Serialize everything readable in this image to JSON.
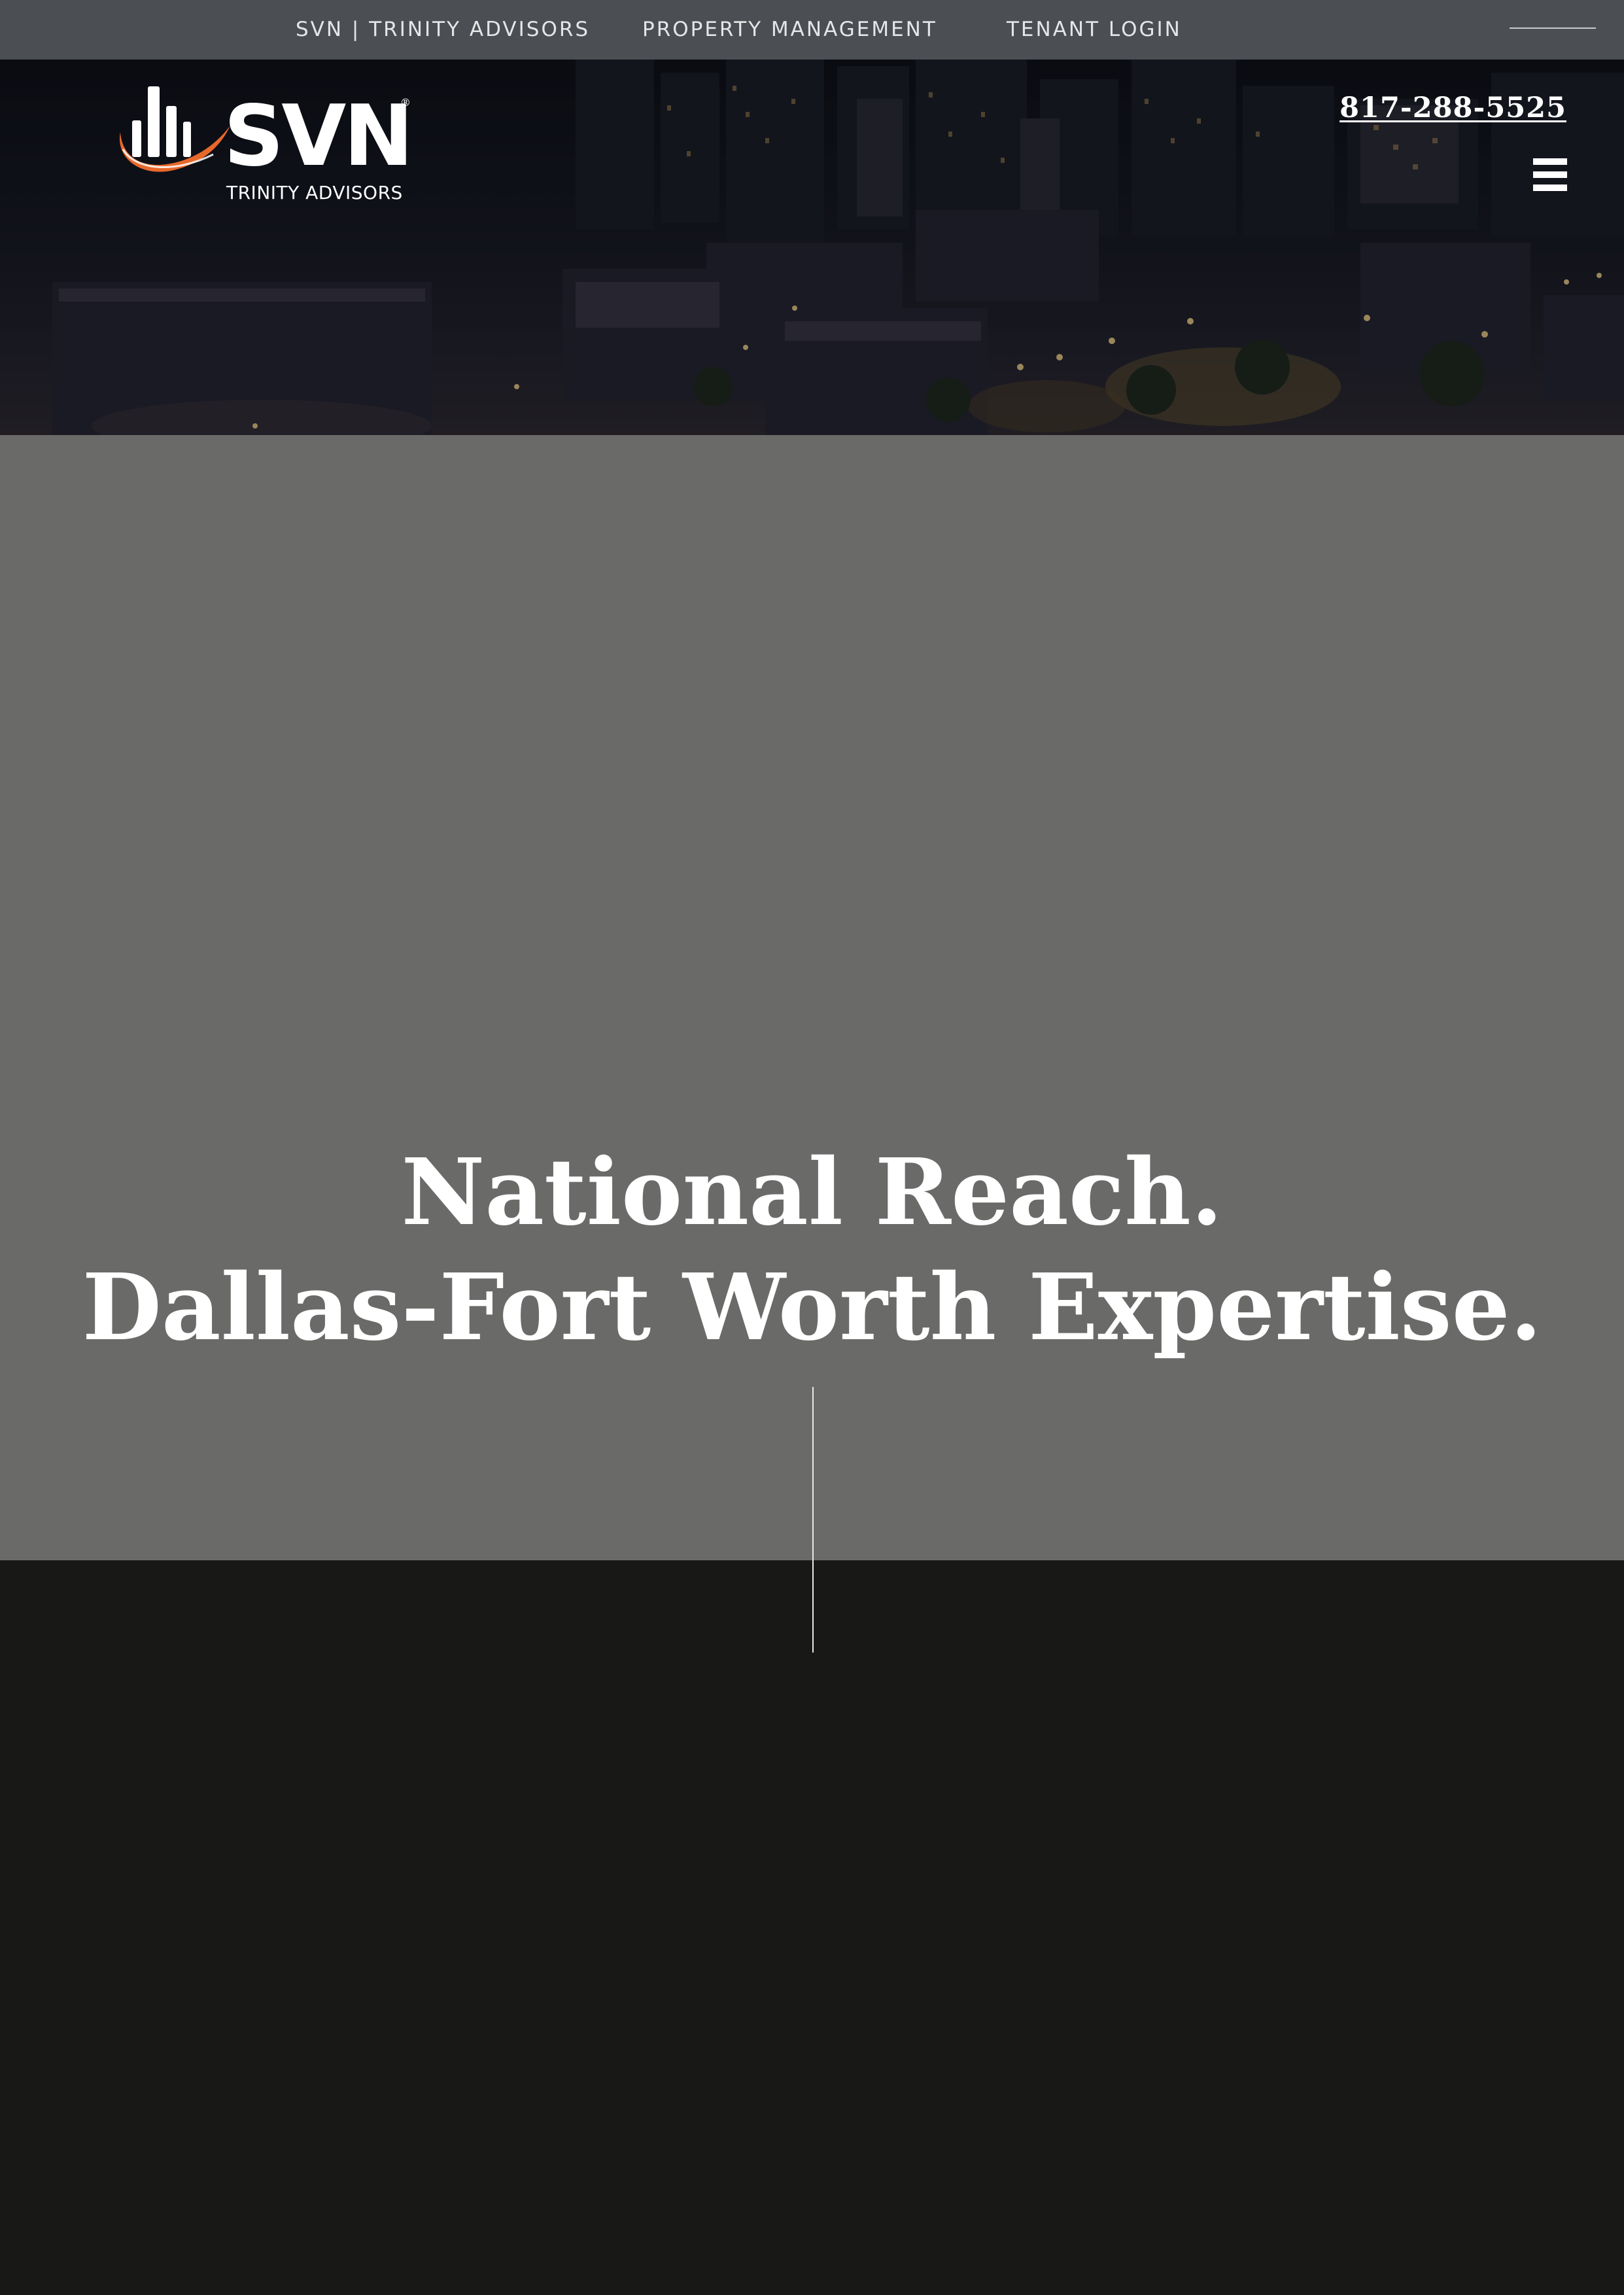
{
  "topbar": {
    "links": [
      {
        "label": "SVN | TRINITY ADVISORS"
      },
      {
        "label": "PROPERTY MANAGEMENT"
      },
      {
        "label": "TENANT LOGIN"
      }
    ]
  },
  "header": {
    "logo": {
      "wordmark": "SVN",
      "registered": "®",
      "subtitle": "TRINITY ADVISORS"
    },
    "phone": "817-288-5525",
    "menu_icon": "hamburger-menu-icon"
  },
  "hero": {
    "headline_line1": "National Reach.",
    "headline_line2": "Dallas-Fort Worth Expertise."
  },
  "colors": {
    "topbar_bg": "#4b4f53",
    "hero_panel_bg": "#6a6a68",
    "lower_bg": "#181817",
    "logo_accent": "#e8682b",
    "text_light": "#ffffff"
  }
}
